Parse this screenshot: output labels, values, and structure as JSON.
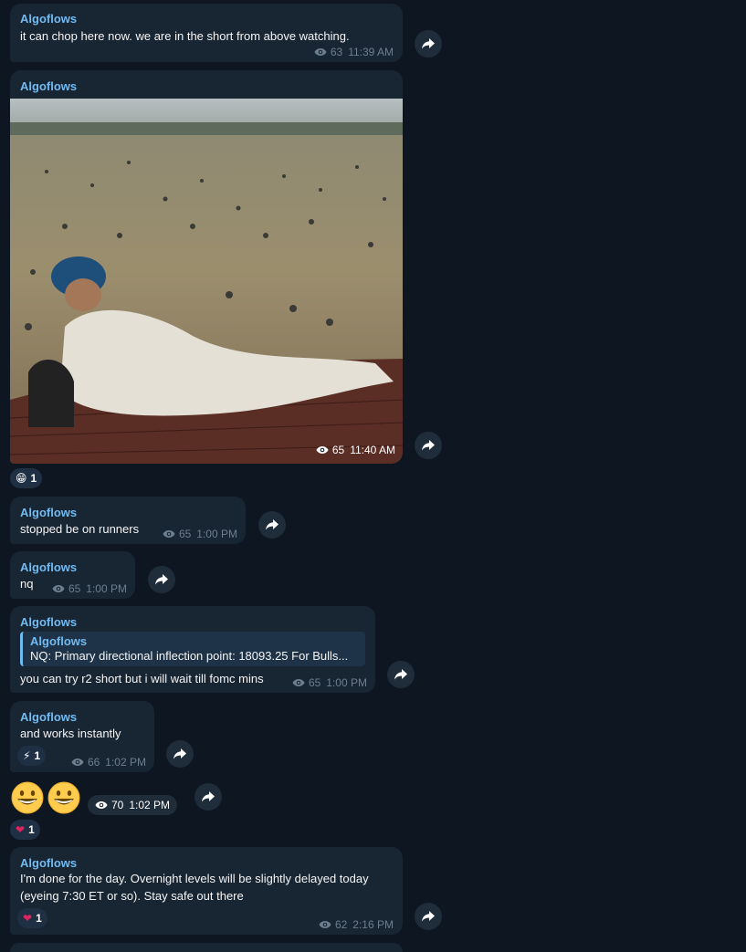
{
  "messages": [
    {
      "sender": "Algoflows",
      "text": "it can chop here now. we are in the short from above watching.",
      "views": "63",
      "time": "11:39 AM"
    },
    {
      "sender": "Algoflows",
      "views": "65",
      "time": "11:40 AM",
      "reaction": {
        "emoji": "grinning-face",
        "count": "1"
      }
    },
    {
      "sender": "Algoflows",
      "text": "stopped be on runners",
      "views": "65",
      "time": "1:00 PM"
    },
    {
      "sender": "Algoflows",
      "text": "nq",
      "views": "65",
      "time": "1:00 PM"
    },
    {
      "sender": "Algoflows",
      "quote": {
        "name": "Algoflows",
        "text": "NQ:  Primary directional inflection point: 18093.25  For Bulls..."
      },
      "text": "you can try r2 short but i will wait till fomc mins",
      "views": "65",
      "time": "1:00 PM"
    },
    {
      "sender": "Algoflows",
      "text": "and works instantly",
      "views": "66",
      "time": "1:02 PM",
      "reaction": {
        "emoji": "high-voltage",
        "count": "1"
      }
    },
    {
      "views": "70",
      "time": "1:02 PM",
      "reaction": {
        "emoji": "red-heart",
        "count": "1"
      }
    },
    {
      "sender": "Algoflows",
      "text": "I'm done for the day. Overnight levels will be slightly delayed today\n(eyeing 7:30 ET or so). Stay safe out there",
      "views": "62",
      "time": "2:16 PM",
      "reaction": {
        "emoji": "red-heart",
        "count": "1"
      }
    }
  ],
  "colors": {
    "background": "#0e1621",
    "bubble": "#182533",
    "sender": "#71baf2",
    "meta": "#6d7f8f"
  },
  "icons": {
    "views": "eye-icon",
    "forward": "forward-arrow-icon"
  }
}
